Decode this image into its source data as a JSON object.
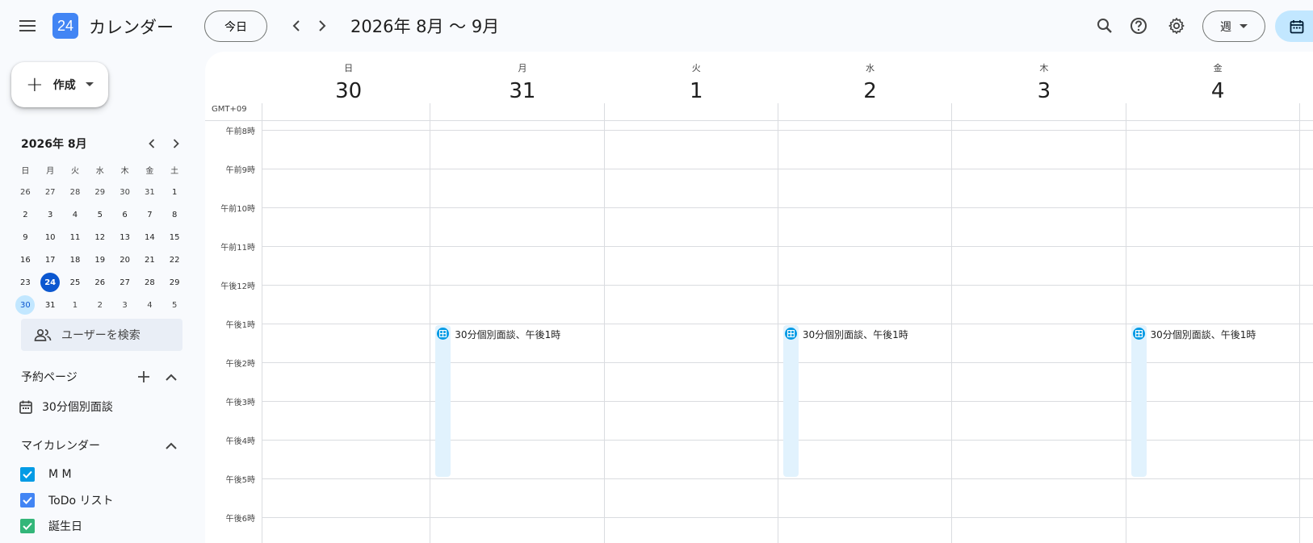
{
  "header": {
    "app_title": "カレンダー",
    "logo_text": "24",
    "today_label": "今日",
    "date_range": "2026年 8月 〜 9月",
    "view_label": "週"
  },
  "sidebar": {
    "create_label": "作成",
    "mini_cal": {
      "title": "2026年 8月",
      "dow": [
        "日",
        "月",
        "火",
        "水",
        "木",
        "金",
        "土"
      ],
      "weeks": [
        [
          "26",
          "27",
          "28",
          "29",
          "30",
          "31",
          "1"
        ],
        [
          "2",
          "3",
          "4",
          "5",
          "6",
          "7",
          "8"
        ],
        [
          "9",
          "10",
          "11",
          "12",
          "13",
          "14",
          "15"
        ],
        [
          "16",
          "17",
          "18",
          "19",
          "20",
          "21",
          "22"
        ],
        [
          "23",
          "24",
          "25",
          "26",
          "27",
          "28",
          "29"
        ],
        [
          "30",
          "31",
          "1",
          "2",
          "3",
          "4",
          "5"
        ]
      ],
      "today": "24",
      "selected": "30"
    },
    "user_search_placeholder": "ユーザーを検索",
    "booking_section": {
      "title": "予約ページ",
      "item": "30分個別面談"
    },
    "my_calendars": {
      "title": "マイカレンダー",
      "items": [
        {
          "label": "M M",
          "color": "#039be5"
        },
        {
          "label": "ToDo リスト",
          "color": "#4285f4"
        },
        {
          "label": "誕生日",
          "color": "#33b679"
        }
      ]
    }
  },
  "grid": {
    "timezone": "GMT+09",
    "days": [
      {
        "dow": "日",
        "num": "30"
      },
      {
        "dow": "月",
        "num": "31"
      },
      {
        "dow": "火",
        "num": "1"
      },
      {
        "dow": "水",
        "num": "2"
      },
      {
        "dow": "木",
        "num": "3"
      },
      {
        "dow": "金",
        "num": "4"
      }
    ],
    "hours": [
      "午前8時",
      "午前9時",
      "午前10時",
      "午前11時",
      "午後12時",
      "午後1時",
      "午後2時",
      "午後3時",
      "午後4時",
      "午後5時",
      "午後6時"
    ],
    "events": [
      {
        "day_index": 1,
        "label": "30分個別面談、午後1時"
      },
      {
        "day_index": 3,
        "label": "30分個別面談、午後1時"
      },
      {
        "day_index": 5,
        "label": "30分個別面談、午後1時"
      }
    ]
  }
}
